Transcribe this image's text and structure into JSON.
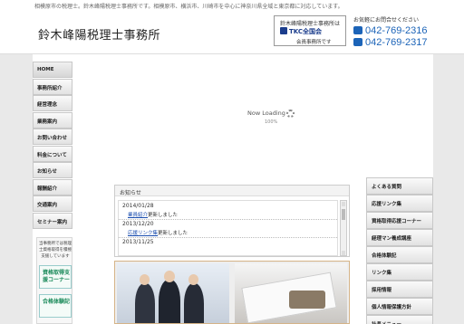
{
  "header": {
    "tagline": "相模原市の税理士。鈴木峰陽税理士事務所です。相模原市、横浜市、川崎市を中心に神奈川県全域と東京都に対応しています。",
    "logo": "鈴木峰陽税理士事務所",
    "tkc": {
      "line1": "鈴木峰陽税理士事務所は",
      "line2": "TKC全国会",
      "line3": "会員事務所です"
    },
    "contact": {
      "title": "お気軽にお問合せください",
      "phone1": "042-769-2316",
      "phone2": "042-769-2317"
    }
  },
  "left_nav": [
    "HOME",
    "事務所紹介",
    "経営理念",
    "業務案内",
    "お問い合わせ",
    "料金について",
    "お知らせ",
    "報酬紹介",
    "交通案内",
    "セミナー案内"
  ],
  "left_box": {
    "text": "当事務所では税理士資格取得を積極支援しています",
    "banner1": "資格取得支援コーナー",
    "banner2": "合格体験記"
  },
  "loading": {
    "text": "Now Loading",
    "percent": "100%"
  },
  "news": {
    "title": "お知らせ",
    "items": [
      {
        "date": "2014/01/28",
        "link": "業員紹介",
        "rest": "更新しました"
      },
      {
        "date": "2013/12/20",
        "link": "応援リンク集",
        "rest": "更新しました"
      },
      {
        "date": "2013/11/25",
        "link": "",
        "rest": ""
      }
    ]
  },
  "right_nav": [
    "よくある質問",
    "応援リンク集",
    "資格取得応援コーナー",
    "経理マン養成講座",
    "合格体験記",
    "リンク集",
    "採用情報",
    "個人情報保護方針",
    "社長メニュー"
  ],
  "colors": {
    "accent": "#1c64b8",
    "tkc": "#1b3d8c",
    "banner": "#1b8a5a"
  }
}
